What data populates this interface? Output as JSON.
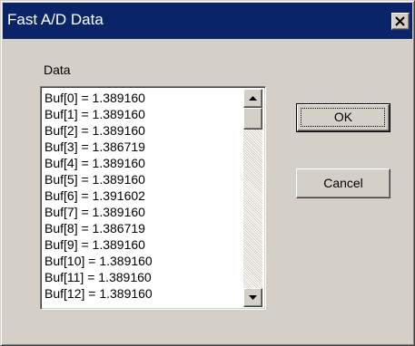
{
  "window": {
    "title": "Fast A/D Data",
    "close_icon": "close-icon"
  },
  "group": {
    "label": "Data"
  },
  "list": {
    "items": [
      "Buf[0] =  1.389160",
      "Buf[1] =  1.389160",
      "Buf[2] =  1.389160",
      "Buf[3] =  1.386719",
      "Buf[4] =  1.389160",
      "Buf[5] =  1.389160",
      "Buf[6] =  1.391602",
      "Buf[7] =  1.389160",
      "Buf[8] =  1.386719",
      "Buf[9] =  1.389160",
      "Buf[10] =  1.389160",
      "Buf[11] =  1.389160",
      "Buf[12] =  1.389160"
    ],
    "scroll_up_icon": "triangle-up-icon",
    "scroll_down_icon": "triangle-down-icon"
  },
  "buttons": {
    "ok_label": "OK",
    "cancel_label": "Cancel"
  },
  "colors": {
    "titlebar": "#0a246a",
    "face": "#d4d0c8",
    "list_bg": "#ffffff"
  }
}
